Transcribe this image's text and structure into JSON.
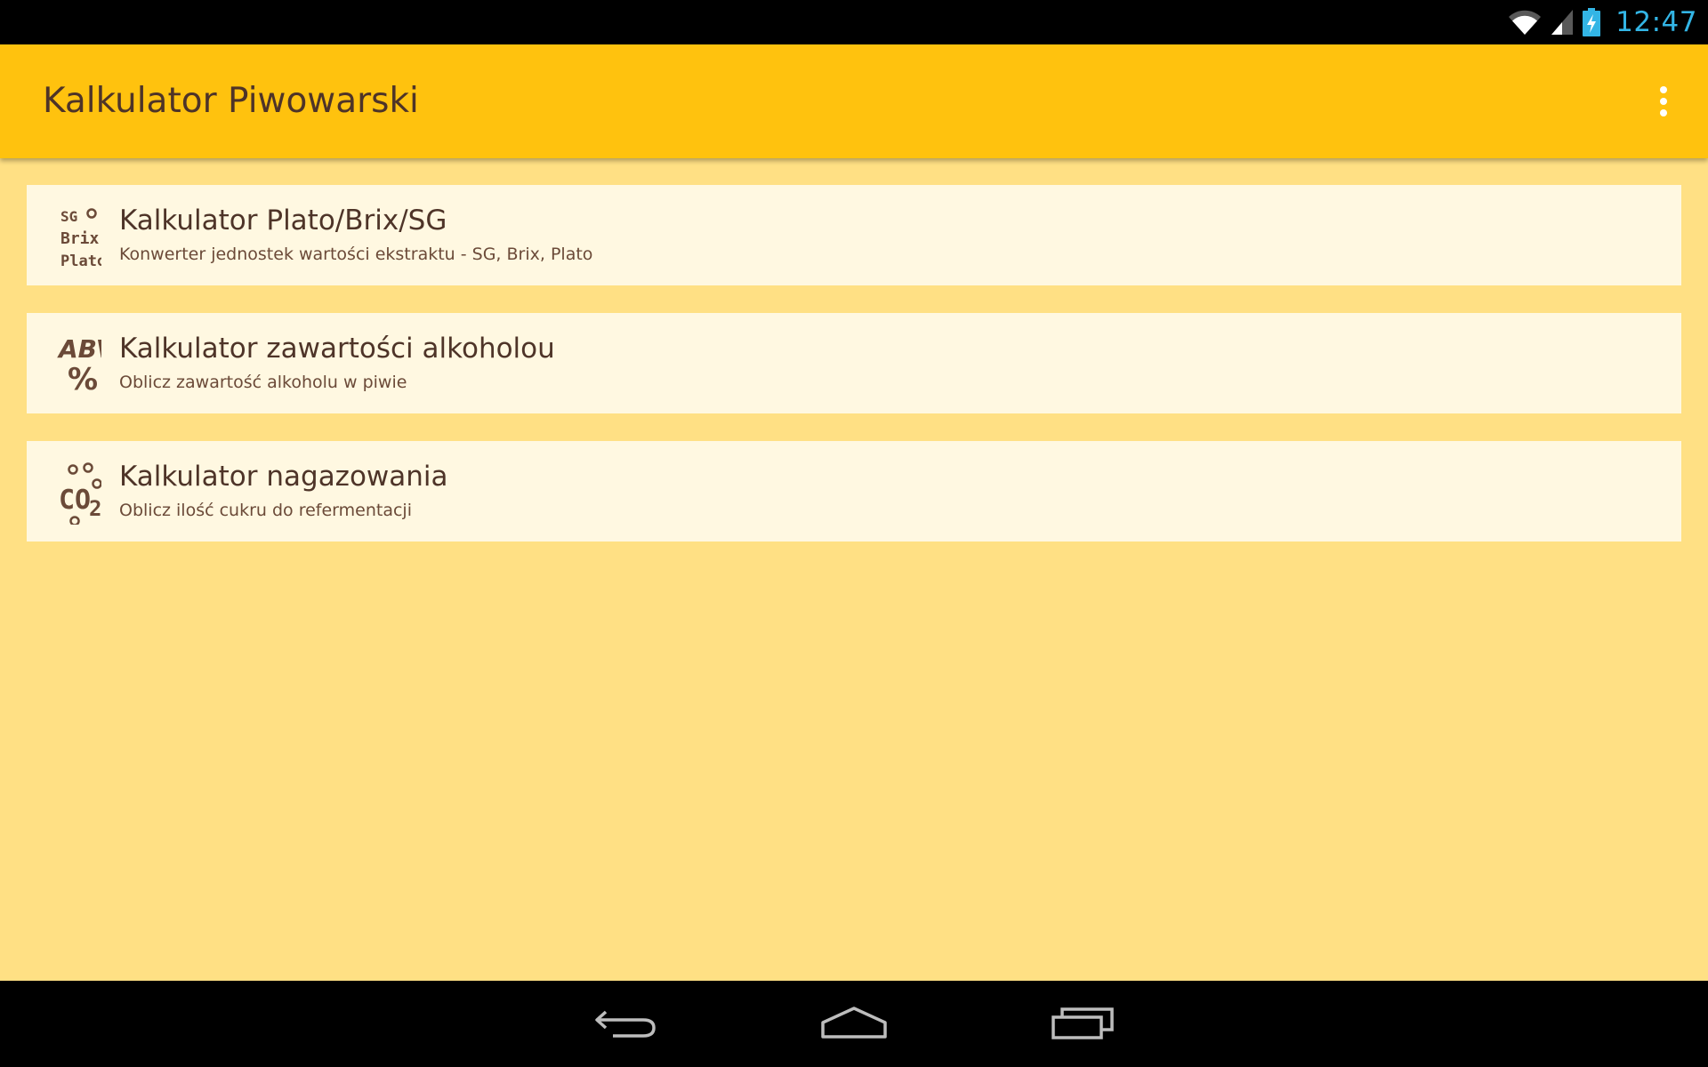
{
  "status_bar": {
    "time": "12:47",
    "icons": [
      "wifi-icon",
      "cell-signal-icon",
      "battery-charging-icon"
    ],
    "clock_color": "#33b5e5"
  },
  "app_bar": {
    "title": "Kalkulator Piwowarski",
    "menu_icon": "overflow-menu-icon",
    "color": "#ffc20e"
  },
  "list": {
    "items": [
      {
        "icon": "sg-brix-plato-icon",
        "title": "Kalkulator Plato/Brix/SG",
        "subtitle": "Konwerter jednostek wartości ekstraktu - SG, Brix, Plato",
        "icon_text": [
          "SG",
          "Brix",
          "Plato"
        ]
      },
      {
        "icon": "abv-percent-icon",
        "title": "Kalkulator zawartości alkoholou",
        "subtitle": "Oblicz zawartość alkoholu w piwie",
        "icon_text": [
          "ABV",
          "%"
        ]
      },
      {
        "icon": "co2-bubbles-icon",
        "title": "Kalkulator nagazowania",
        "subtitle": "Oblicz ilość cukru do refermentacji",
        "icon_text": [
          "CO",
          "2"
        ]
      }
    ]
  },
  "nav_bar": {
    "buttons": [
      "back-icon",
      "home-icon",
      "recent-apps-icon"
    ]
  },
  "colors": {
    "background": "#ffe084",
    "card": "#fff8e1",
    "text": "#4e3428"
  }
}
